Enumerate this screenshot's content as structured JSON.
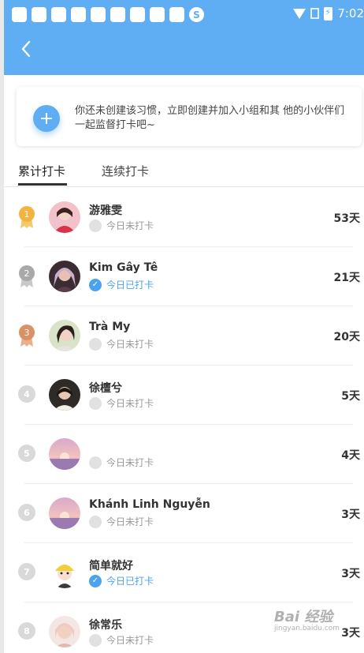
{
  "statusbar": {
    "time": "7:02",
    "sogou_icon_letter": "S"
  },
  "invite": {
    "text": "你还未创建该习惯，立即创建并加入小组和其 他的小伙伴们一起监督打卡吧~",
    "add_icon": "+"
  },
  "tabs": [
    {
      "label": "累计打卡",
      "active": true
    },
    {
      "label": "连续打卡",
      "active": false
    }
  ],
  "ranking": [
    {
      "rank": "1",
      "name": "游雅雯",
      "status": "今日未打卡",
      "checked": false,
      "days": "53天",
      "medal": "gold",
      "avatar": "avatar-1"
    },
    {
      "rank": "2",
      "name": "Kim Gây Tê",
      "status": "今日已打卡",
      "checked": true,
      "days": "21天",
      "medal": "silver",
      "avatar": "avatar-2"
    },
    {
      "rank": "3",
      "name": "Trà My",
      "status": "今日未打卡",
      "checked": false,
      "days": "20天",
      "medal": "bronze",
      "avatar": "avatar-3"
    },
    {
      "rank": "4",
      "name": "徐檀兮",
      "status": "今日未打卡",
      "checked": false,
      "days": "5天",
      "medal": "none",
      "avatar": "avatar-4"
    },
    {
      "rank": "5",
      "name": "",
      "status": "今日未打卡",
      "checked": false,
      "days": "4天",
      "medal": "none",
      "avatar": "avatar-5"
    },
    {
      "rank": "6",
      "name": "Khánh Linh Nguyễn",
      "status": "今日未打卡",
      "checked": false,
      "days": "3天",
      "medal": "none",
      "avatar": "avatar-6"
    },
    {
      "rank": "7",
      "name": "简单就好",
      "status": "今日已打卡",
      "checked": true,
      "days": "3天",
      "medal": "none",
      "avatar": "avatar-7"
    },
    {
      "rank": "8",
      "name": "徐常乐",
      "status": "今日未打卡",
      "checked": false,
      "days": "3天",
      "medal": "none",
      "avatar": "avatar-8"
    }
  ],
  "watermark": {
    "logo": "Bai 经验",
    "sub": "jingyan.baidu.com"
  },
  "colors": {
    "primary": "#5fadf3",
    "checked": "#4aa3ef",
    "gold": "#f3b43f",
    "silver": "#a9a9a9",
    "bronze": "#d99266"
  }
}
